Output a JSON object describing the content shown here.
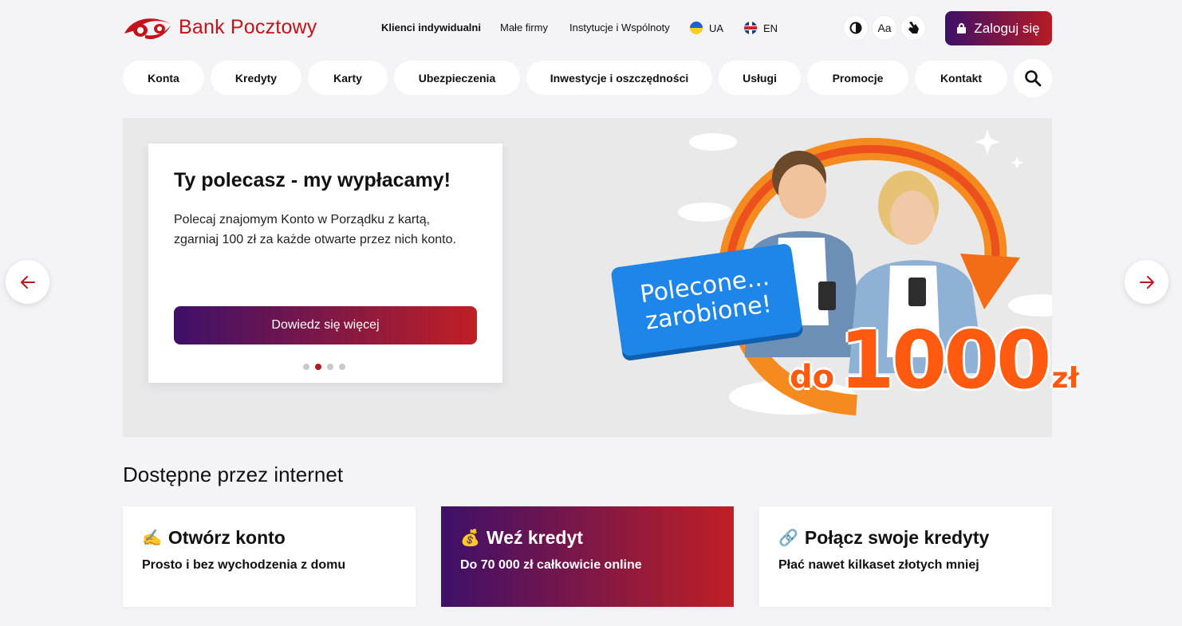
{
  "brand": {
    "name": "Bank Pocztowy",
    "color": "#c4141b",
    "gradient": [
      "#3d1068",
      "#c01f25"
    ]
  },
  "topnav": [
    {
      "label": "Klienci indywidualni",
      "active": true
    },
    {
      "label": "Małe firmy",
      "active": false
    },
    {
      "label": "Instytucje i Wspólnoty",
      "active": false
    }
  ],
  "languages": [
    {
      "code": "UA",
      "icon": "ukraine-flag-icon"
    },
    {
      "code": "EN",
      "icon": "uk-flag-icon"
    }
  ],
  "tools": {
    "contrast_icon": "contrast-icon",
    "font_size_label": "Aa",
    "sign_language_icon": "sign-language-icon"
  },
  "login": {
    "label": "Zaloguj się",
    "icon": "lock-icon"
  },
  "menu": [
    {
      "label": "Konta"
    },
    {
      "label": "Kredyty"
    },
    {
      "label": "Karty"
    },
    {
      "label": "Ubezpieczenia"
    },
    {
      "label": "Inwestycje i oszczędności"
    },
    {
      "label": "Usługi"
    },
    {
      "label": "Promocje"
    },
    {
      "label": "Kontakt"
    }
  ],
  "search": {
    "icon": "search-icon"
  },
  "hero": {
    "title": "Ty polecasz - my wypłacamy!",
    "text": "Polecaj znajomym Konto w Porządku z kartą, zgarniaj 100 zł za każde otwarte przez nich konto.",
    "cta": "Dowiedz się więcej",
    "slides_total": 4,
    "active_slide": 2,
    "promo_line1": "Polecone...",
    "promo_line2": "zarobione!",
    "promo_prefix": "do",
    "promo_amount": "1000",
    "promo_currency": "zł"
  },
  "carousel": {
    "prev_icon": "arrow-left-icon",
    "next_icon": "arrow-right-icon"
  },
  "online": {
    "title": "Dostępne przez internet",
    "tiles": [
      {
        "emoji": "✍️",
        "title": "Otwórz konto",
        "subtitle": "Prosto i bez wychodzenia z domu"
      },
      {
        "emoji": "💰",
        "title": "Weź kredyt",
        "subtitle": "Do 70 000 zł całkowicie online"
      },
      {
        "emoji": "🔗",
        "title": "Połącz swoje kredyty",
        "subtitle": "Płać nawet kilkaset złotych mniej"
      }
    ]
  }
}
